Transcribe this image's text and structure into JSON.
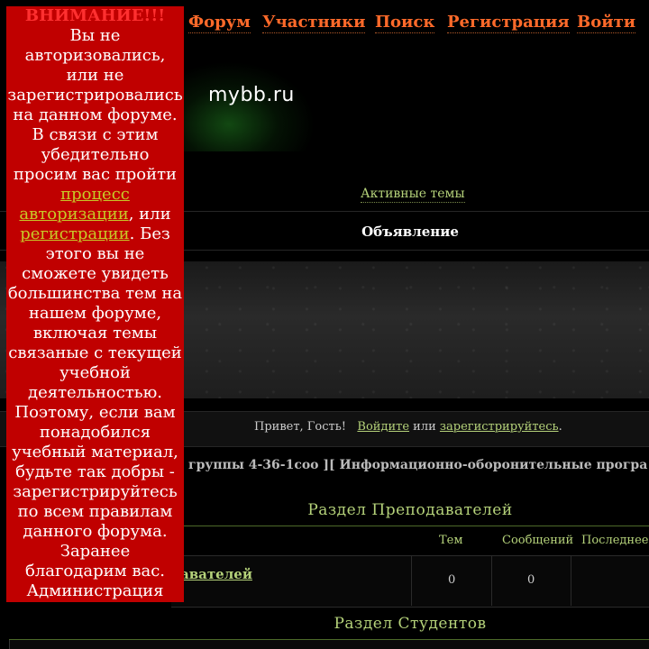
{
  "nav": {
    "items": [
      "Форум",
      "Участники",
      "Поиск",
      "Регистрация",
      "Войти"
    ]
  },
  "logo": "mybb.ru",
  "active_topics": "Активные темы",
  "announcement_title": "Объявление",
  "greeting": {
    "prefix": "Привет, Гость!",
    "login_link": "Войдите",
    "or": "или",
    "register_link": "зарегистрируйтесь",
    "suffix": "."
  },
  "marquee_text": "группы 4-36-1соо ][ Информационно-оборонительные програ",
  "sections": [
    {
      "title": "Раздел Преподавателей",
      "columns": [
        "Тем",
        "Сообщений",
        "Последнее"
      ],
      "rows": [
        {
          "forum": "аватeлей",
          "topics": "0",
          "posts": "0"
        }
      ]
    },
    {
      "title": "Раздел Студентов"
    }
  ],
  "alert": {
    "title": "ВНИМАНИЕ!!!",
    "text1": "Вы не авторизовались, или не зарегистрировались на данном форуме. В связи с этим убедительно просим вас пройти",
    "link1": "процесс авторизации",
    "text2": ", или",
    "link2": "регистрации",
    "text3": ". Без этого вы не сможете увидеть большинства тем на нашем форуме, включая темы связаные с текущей учебной деятельностью. Поэтому, если вам понадобился учебный материал, будьте так добры - зарегистрируйтесь по всем правилам данного форума. Заранее благодарим вас. Администрация"
  },
  "colors": {
    "nav": "#ff6a2a",
    "accent": "#b5d27a",
    "alert_bg": "#c00000",
    "alert_title": "#ff3030",
    "alert_link": "#c8c828"
  }
}
